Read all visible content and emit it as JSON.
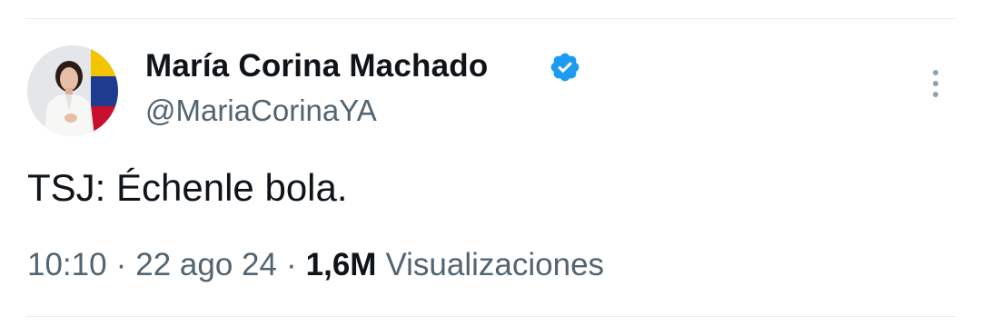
{
  "tweet": {
    "author": {
      "display_name": "María Corina Machado",
      "handle": "@MariaCorinaYA",
      "verified": true,
      "verified_icon": "verified-badge-icon"
    },
    "text": "TSJ: Échenle bola.",
    "meta": {
      "time": "10:10",
      "separator": "·",
      "date": "22 ago 24",
      "views_count": "1,6M",
      "views_label": "Visualizaciones"
    }
  },
  "colors": {
    "text_primary": "#0f1419",
    "text_secondary": "#536471",
    "verified_blue": "#1d9bf0",
    "divider": "#e6ecf0"
  }
}
